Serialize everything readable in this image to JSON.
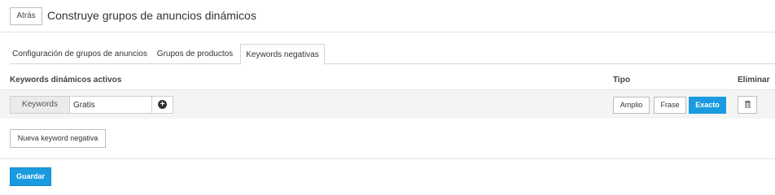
{
  "header": {
    "back_label": "Atrás",
    "title": "Construye grupos de anuncios dinámicos"
  },
  "tabs": [
    {
      "label": "Configuración de grupos de anuncios",
      "active": false
    },
    {
      "label": "Grupos de productos",
      "active": false
    },
    {
      "label": "Keywords negativas",
      "active": true
    }
  ],
  "table": {
    "col_keywords": "Keywords dinámicos activos",
    "col_tipo": "Tipo",
    "col_eliminar": "Eliminar",
    "rows": [
      {
        "addon_label": "Keywords",
        "value": "Gratis",
        "add_icon": "plus-circle-icon",
        "match_types": [
          "Amplio",
          "Frase",
          "Exacto"
        ],
        "selected_match_type": "Exacto",
        "delete_icon": "trash-icon"
      }
    ]
  },
  "actions": {
    "new_keyword_label": "Nueva keyword negativa",
    "save_label": "Guardar"
  },
  "colors": {
    "accent": "#1a9be0",
    "row_background": "#f4f4f4"
  }
}
